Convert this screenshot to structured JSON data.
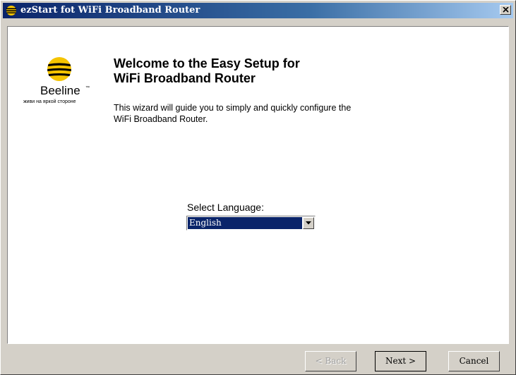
{
  "window": {
    "title": "ezStart fot WiFi Broadband Router",
    "close_label": "×"
  },
  "logo": {
    "name": "Beeline",
    "trademark": "™",
    "slogan": "живи на яркой стороне",
    "colors": {
      "yellow": "#f5c400",
      "black": "#000000"
    }
  },
  "welcome": {
    "title_line1": "Welcome to the Easy Setup for",
    "title_line2": "WiFi Broadband Router",
    "desc_line1": "This wizard will guide you to simply and quickly configure the",
    "desc_line2": "WiFi Broadband Router."
  },
  "language": {
    "label": "Select Language:",
    "selected": "English"
  },
  "buttons": {
    "back": "< Back",
    "next": "Next >",
    "cancel": "Cancel"
  },
  "colors": {
    "dialog_bg": "#d4d0c8",
    "selection": "#0a246a",
    "titlebar_start": "#0a246a",
    "titlebar_end": "#a6caf0"
  }
}
